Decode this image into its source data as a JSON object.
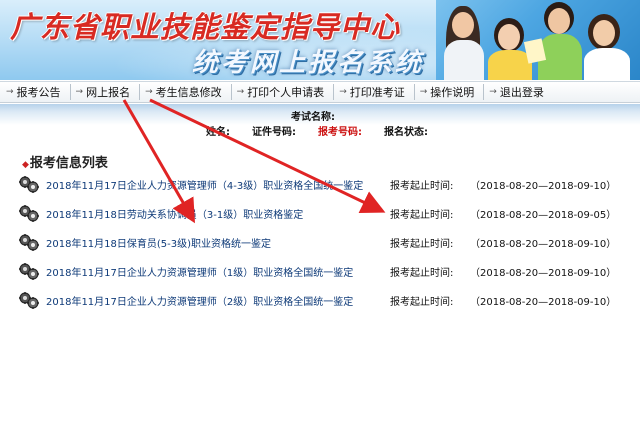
{
  "banner": {
    "title": "广东省职业技能鉴定指导中心",
    "subtitle": "统考网上报名系统"
  },
  "nav": {
    "items": [
      {
        "label": "报考公告"
      },
      {
        "label": "网上报名"
      },
      {
        "label": "考生信息修改"
      },
      {
        "label": "打印个人申请表"
      },
      {
        "label": "打印准考证"
      },
      {
        "label": "操作说明"
      },
      {
        "label": "退出登录"
      }
    ]
  },
  "info": {
    "exam_name_label": "考试名称:",
    "name_label": "姓名:",
    "id_label": "证件号码:",
    "exam_no_label": "报考号码:",
    "status_label": "报名状态:"
  },
  "list": {
    "title": "报考信息列表",
    "period_label": "报考起止时间:",
    "items": [
      {
        "name": "2018年11月17日企业人力资源管理师（4-3级）职业资格全国统一鉴定",
        "period": "（2018-08-20—2018-09-10）"
      },
      {
        "name": "2018年11月18日劳动关系协调员（3-1级）职业资格鉴定",
        "period": "（2018-08-20—2018-09-05）"
      },
      {
        "name": "2018年11月18日保育员(5-3级)职业资格统一鉴定",
        "period": "（2018-08-20—2018-09-10）"
      },
      {
        "name": "2018年11月17日企业人力资源管理师（1级）职业资格全国统一鉴定",
        "period": "（2018-08-20—2018-09-10）"
      },
      {
        "name": "2018年11月17日企业人力资源管理师（2级）职业资格全国统一鉴定",
        "period": "（2018-08-20—2018-09-10）"
      }
    ]
  },
  "colors": {
    "title_red": "#d82a22",
    "link_blue": "#0e3a78",
    "annotation_arrow": "#e02424"
  }
}
